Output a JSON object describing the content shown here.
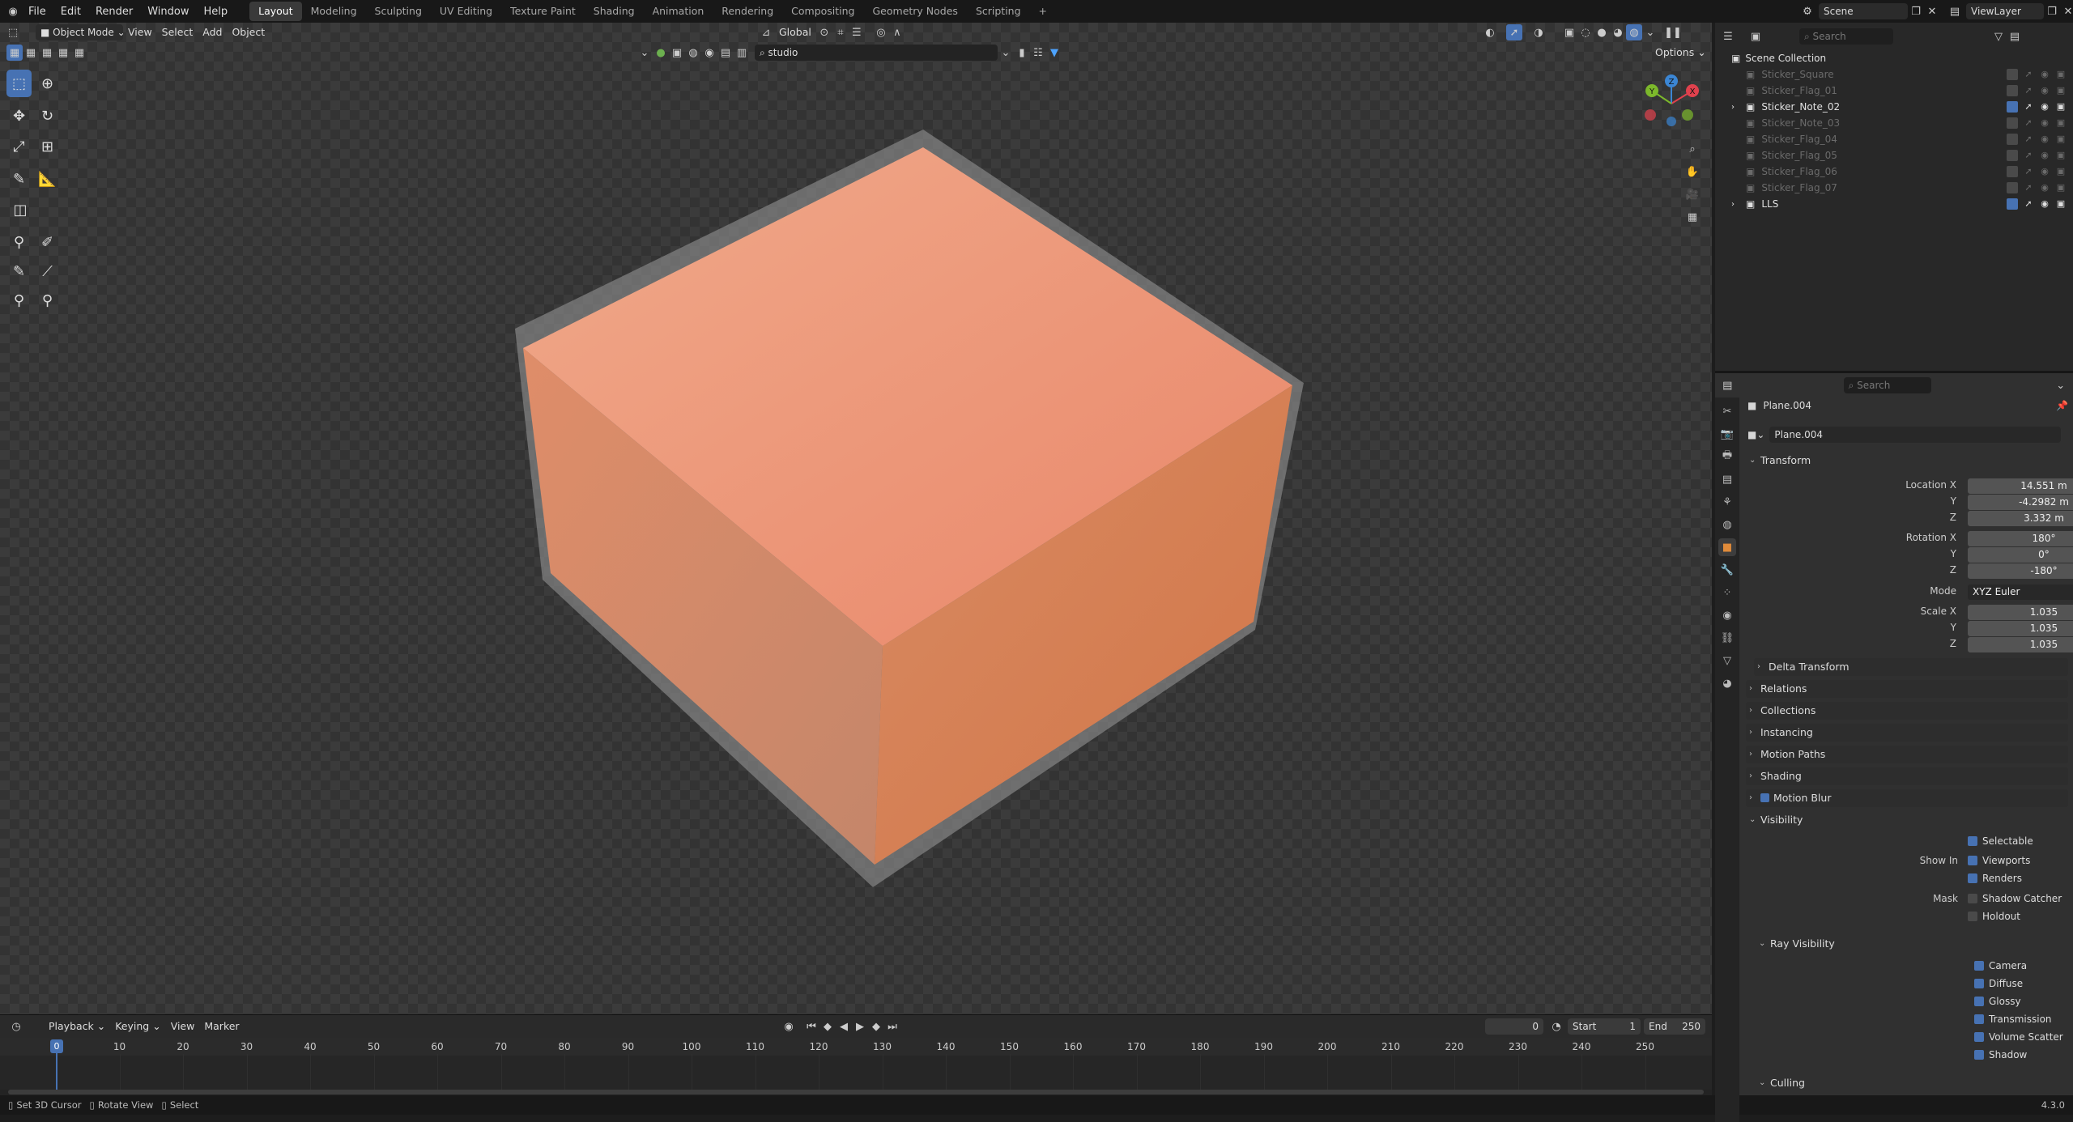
{
  "top_menu": [
    "File",
    "Edit",
    "Render",
    "Window",
    "Help"
  ],
  "workspaces": [
    "Layout",
    "Modeling",
    "Sculpting",
    "UV Editing",
    "Texture Paint",
    "Shading",
    "Animation",
    "Rendering",
    "Compositing",
    "Geometry Nodes",
    "Scripting"
  ],
  "add_workspace_icon": "+",
  "scene": {
    "label": "Scene"
  },
  "view_layer": {
    "label": "ViewLayer"
  },
  "viewport": {
    "mode": "Object Mode",
    "menus": [
      "View",
      "Select",
      "Add",
      "Object"
    ],
    "orientation": "Global",
    "hdri_search": "studio",
    "options_label": "Options",
    "cube_colors": {
      "top": "#f0a98a",
      "left": "#df8d69",
      "right": "#d27547",
      "glass": "#8a8a8a"
    },
    "gizmo": {
      "x": "X",
      "y": "Y",
      "z": "Z",
      "x_color": "#e0414d",
      "y_color": "#7cb82b",
      "z_color": "#3b86d4"
    }
  },
  "timeline": {
    "menus": [
      "Playback",
      "Keying",
      "View",
      "Marker"
    ],
    "current_frame": "0",
    "start_label": "Start",
    "start": "1",
    "end_label": "End",
    "end": "250",
    "playhead": "0",
    "ticks": [
      "10",
      "20",
      "30",
      "40",
      "50",
      "60",
      "70",
      "80",
      "90",
      "100",
      "110",
      "120",
      "130",
      "140",
      "150",
      "160",
      "170",
      "180",
      "190",
      "200",
      "210",
      "220",
      "230",
      "240",
      "250"
    ]
  },
  "statusbar": {
    "items": [
      "Set 3D Cursor",
      "Rotate View",
      "Select"
    ],
    "version": "4.3.0"
  },
  "outliner": {
    "search_placeholder": "Search",
    "root": "Scene Collection",
    "items": [
      {
        "name": "Sticker_Square",
        "visible": false
      },
      {
        "name": "Sticker_Flag_01",
        "visible": false
      },
      {
        "name": "Sticker_Note_02",
        "visible": true
      },
      {
        "name": "Sticker_Note_03",
        "visible": false
      },
      {
        "name": "Sticker_Flag_04",
        "visible": false
      },
      {
        "name": "Sticker_Flag_05",
        "visible": false
      },
      {
        "name": "Sticker_Flag_06",
        "visible": false
      },
      {
        "name": "Sticker_Flag_07",
        "visible": false
      },
      {
        "name": "LLS",
        "visible": true
      }
    ]
  },
  "properties": {
    "search_placeholder": "Search",
    "object_name": "Plane.004",
    "datablock_name": "Plane.004",
    "transform": {
      "title": "Transform",
      "location_label": "Location X",
      "location": [
        "14.551 m",
        "-4.2982 m",
        "3.332 m"
      ],
      "rotation_label": "Rotation X",
      "rotation": [
        "180°",
        "0°",
        "-180°"
      ],
      "mode_label": "Mode",
      "mode": "XYZ Euler",
      "scale_label": "Scale X",
      "scale": [
        "1.035",
        "1.035",
        "1.035"
      ],
      "axis_y": "Y",
      "axis_z": "Z"
    },
    "panels": [
      "Delta Transform",
      "Relations",
      "Collections",
      "Instancing",
      "Motion Paths",
      "Shading",
      "Motion Blur"
    ],
    "visibility": {
      "title": "Visibility",
      "selectable": "Selectable",
      "show_in_label": "Show In",
      "viewports": "Viewports",
      "renders": "Renders",
      "mask_label": "Mask",
      "shadow_catcher": "Shadow Catcher",
      "holdout": "Holdout"
    },
    "ray_visibility": {
      "title": "Ray Visibility",
      "items": [
        "Camera",
        "Diffuse",
        "Glossy",
        "Transmission",
        "Volume Scatter",
        "Shadow"
      ]
    },
    "culling": "Culling"
  }
}
